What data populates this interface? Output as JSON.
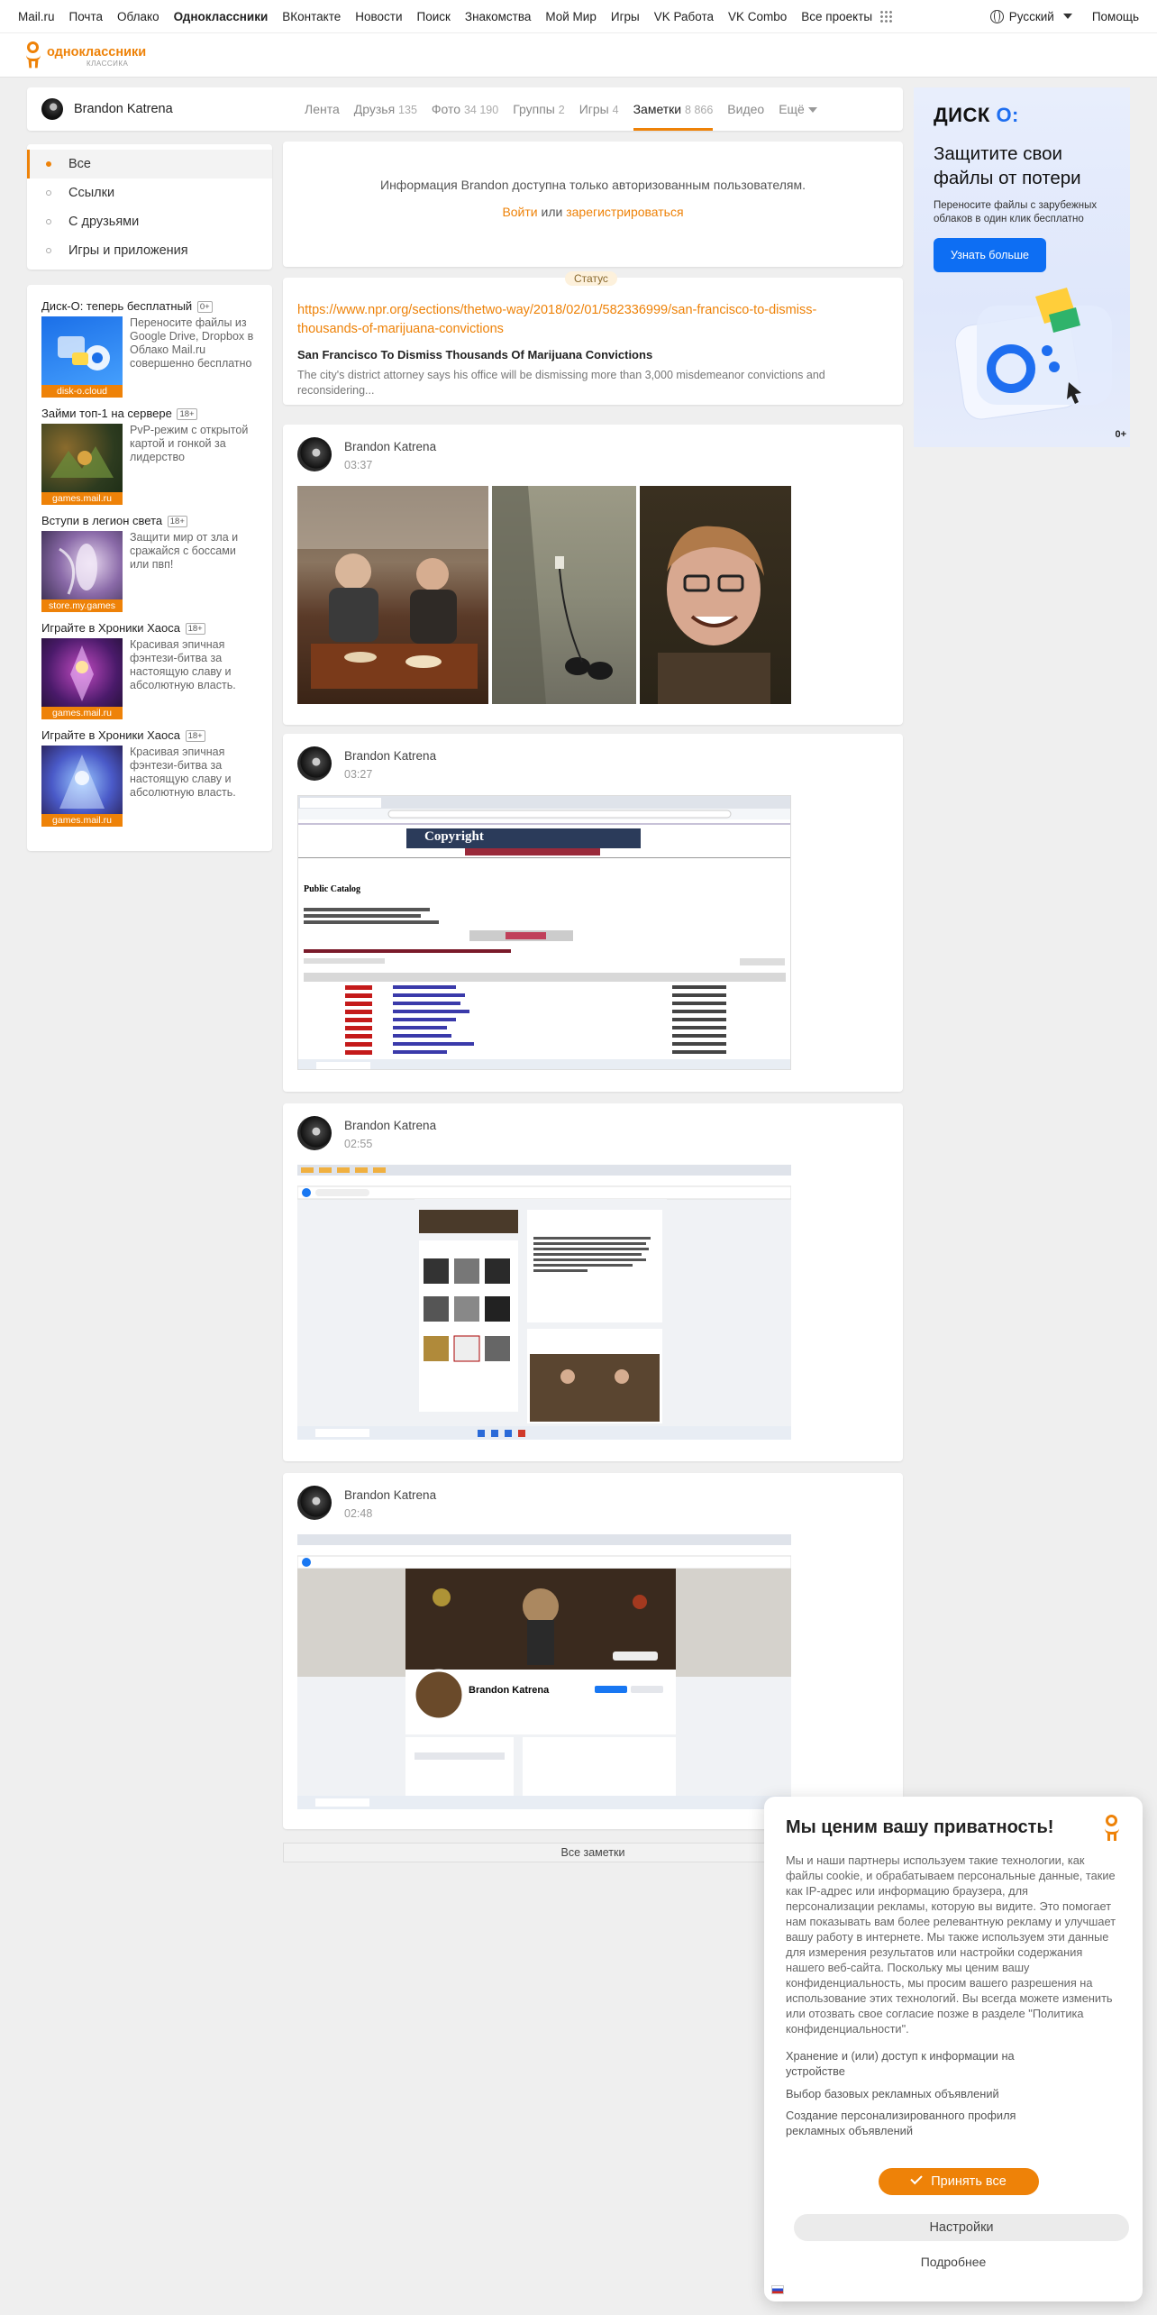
{
  "portal": {
    "links": [
      "Mail.ru",
      "Почта",
      "Облако",
      "Одноклассники",
      "ВКонтакте",
      "Новости",
      "Поиск",
      "Знакомства",
      "Мой Мир",
      "Игры",
      "VK Работа",
      "VK Combo",
      "Все проекты"
    ],
    "active_link": "Одноклассники",
    "language": "Русский",
    "help": "Помощь"
  },
  "logo": {
    "text": "одноклассники",
    "sub": "КЛАССИКА"
  },
  "profile": {
    "name": "Brandon Katrena",
    "tabs": [
      {
        "label": "Лента",
        "count": ""
      },
      {
        "label": "Друзья",
        "count": "135"
      },
      {
        "label": "Фото",
        "count": "34 190"
      },
      {
        "label": "Группы",
        "count": "2"
      },
      {
        "label": "Игры",
        "count": "4"
      },
      {
        "label": "Заметки",
        "count": "8 866"
      },
      {
        "label": "Видео",
        "count": ""
      },
      {
        "label": "Ещё",
        "count": ""
      }
    ],
    "active_tab": "Заметки"
  },
  "filters": {
    "items": [
      "Все",
      "Ссылки",
      "С друзьями",
      "Игры и приложения"
    ],
    "active": "Все"
  },
  "ads": [
    {
      "title": "Диск-О: теперь бесплатный",
      "age": "0+",
      "text": "Переносите файлы из Google Drive, Dropbox в Облако Mail.ru совершенно бесплатно",
      "source": "disk-o.cloud"
    },
    {
      "title": "Займи топ-1 на сервере",
      "age": "18+",
      "text": "PvP-режим с открытой картой и гонкой за лидерство",
      "source": "games.mail.ru"
    },
    {
      "title": "Вступи в легион света",
      "age": "18+",
      "text": "Защити мир от зла и сражайся с боссами или пвп!",
      "source": "store.my.games"
    },
    {
      "title": "Играйте в Хроники Хаоса",
      "age": "18+",
      "text": "Красивая эпичная фэнтези-битва за настоящую славу и абсолютную власть.",
      "source": "games.mail.ru"
    },
    {
      "title": "Играйте в Хроники Хаоса",
      "age": "18+",
      "text": "Красивая эпичная фэнтези-битва за настоящую славу и абсолютную власть.",
      "source": "games.mail.ru"
    }
  ],
  "auth": {
    "message": "Информация Brandon доступна только авторизованным пользователям.",
    "login": "Войти",
    "or": "или",
    "register": "зарегистрироваться"
  },
  "status": {
    "badge": "Статус",
    "url": "https://www.npr.org/sections/thetwo-way/2018/02/01/582336999/san-francisco-to-dismiss-thousands-of-marijuana-convictions",
    "title": "San Francisco To Dismiss Thousands Of Marijuana Convictions",
    "description": "The city's district attorney says his office will be dismissing more than 3,000 misdemeanor convictions and reconsidering..."
  },
  "posts": [
    {
      "author": "Brandon Katrena",
      "time": "03:37"
    },
    {
      "author": "Brandon Katrena",
      "time": "03:27"
    },
    {
      "author": "Brandon Katrena",
      "time": "02:55"
    },
    {
      "author": "Brandon Katrena",
      "time": "02:48"
    }
  ],
  "screenshots": {
    "catalog_title": "Copyright",
    "catalog_heading": "Public Catalog",
    "fb_profile_name": "Brandon Katrena"
  },
  "all_notes": "Все заметки",
  "banner": {
    "logo": "ДИСК",
    "logo_o": "О:",
    "headline": "Защитите свои файлы от потери",
    "sub": "Переносите файлы с зарубежных облаков в один клик бесплатно",
    "button": "Узнать больше",
    "age": "0+"
  },
  "privacy": {
    "title": "Мы ценим вашу приватность!",
    "text": "Мы и наши партнеры используем такие технологии, как файлы cookie, и обрабатываем персональные данные, такие как IP-адрес или информацию браузера, для персонализации рекламы, которую вы видите. Это помогает нам показывать вам более релевантную рекламу и улучшает вашу работу в интернете. Мы также используем эти данные для измерения результатов или настройки содержания нашего веб-сайта. Поскольку мы ценим вашу конфиденциальность, мы просим вашего разрешения на использование этих технологий. Вы всегда можете изменить или отозвать свое согласие позже в разделе \"Политика конфиденциальности\".",
    "purposes": [
      "Хранение и (или) доступ к информации на устройстве",
      "Выбор базовых рекламных объявлений",
      "Создание персонализированного профиля рекламных объявлений"
    ],
    "accept": "Принять все",
    "settings": "Настройки",
    "more": "Подробнее"
  },
  "colors": {
    "accent": "#ee8208",
    "link": "#ee8208",
    "banner_button": "#0d6ef3"
  }
}
